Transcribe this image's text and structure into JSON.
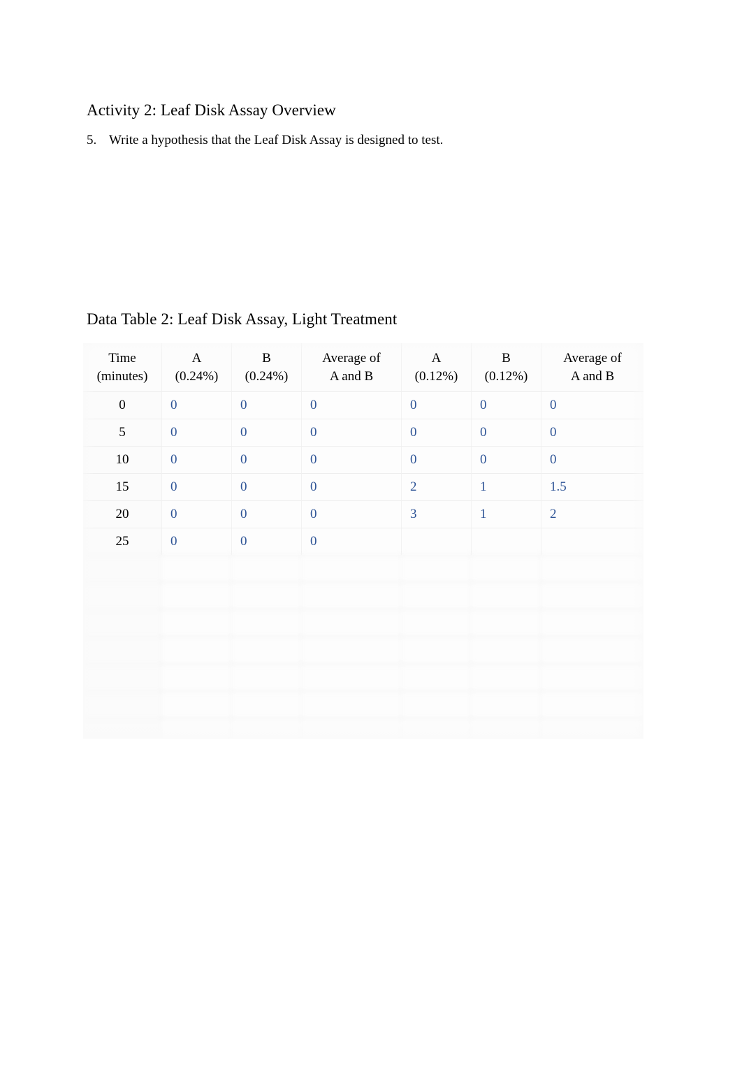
{
  "document": {
    "activity_heading": "Activity 2: Leaf Disk Assay Overview",
    "question": {
      "number": "5.",
      "text": "Write a hypothesis that the Leaf Disk Assay is designed to test."
    },
    "table_heading": "Data Table 2: Leaf Disk Assay, Light Treatment"
  },
  "colors": {
    "body_text": "#000000",
    "entered_value": "#2e5496",
    "table_background": "#fafafa",
    "page_background": "#ffffff"
  },
  "data_table": {
    "headers": [
      {
        "line1": "Time",
        "line2": "(minutes)"
      },
      {
        "line1": "A",
        "line2": "(0.24%)"
      },
      {
        "line1": "B",
        "line2": "(0.24%)"
      },
      {
        "line1": "Average of",
        "line2": "A and B"
      },
      {
        "line1": "A",
        "line2": "(0.12%)"
      },
      {
        "line1": "B",
        "line2": "(0.12%)"
      },
      {
        "line1": "Average of",
        "line2": "A and B"
      }
    ],
    "rows": [
      {
        "time": "0",
        "a24": "0",
        "b24": "0",
        "avg24": "0",
        "a12": "0",
        "b12": "0",
        "avg12": "0"
      },
      {
        "time": "5",
        "a24": "0",
        "b24": "0",
        "avg24": "0",
        "a12": "0",
        "b12": "0",
        "avg12": "0"
      },
      {
        "time": "10",
        "a24": "0",
        "b24": "0",
        "avg24": "0",
        "a12": "0",
        "b12": "0",
        "avg12": "0"
      },
      {
        "time": "15",
        "a24": "0",
        "b24": "0",
        "avg24": "0",
        "a12": "2",
        "b12": "1",
        "avg12": "1.5"
      },
      {
        "time": "20",
        "a24": "0",
        "b24": "0",
        "avg24": "0",
        "a12": "3",
        "b12": "1",
        "avg12": "2"
      },
      {
        "time": "25",
        "a24": "0",
        "b24": "0",
        "avg24": "0",
        "a12": "",
        "b12": "",
        "avg12": ""
      }
    ],
    "obscured_rows": [
      {
        "time": "",
        "a24": "",
        "b24": "",
        "avg24": "",
        "a12": "",
        "b12": "",
        "avg12": ""
      },
      {
        "time": "",
        "a24": "",
        "b24": "",
        "avg24": "",
        "a12": "",
        "b12": "",
        "avg12": ""
      },
      {
        "time": "",
        "a24": "",
        "b24": "",
        "avg24": "",
        "a12": "",
        "b12": "",
        "avg12": ""
      },
      {
        "time": "",
        "a24": "",
        "b24": "",
        "avg24": "",
        "a12": "",
        "b12": "",
        "avg12": ""
      },
      {
        "time": "",
        "a24": "",
        "b24": "",
        "avg24": "",
        "a12": "",
        "b12": "",
        "avg12": ""
      },
      {
        "time": "",
        "a24": "",
        "b24": "",
        "avg24": "",
        "a12": "",
        "b12": "",
        "avg12": ""
      },
      {
        "time": "",
        "a24": "",
        "b24": "",
        "avg24": "",
        "a12": "",
        "b12": "",
        "avg12": ""
      }
    ]
  }
}
